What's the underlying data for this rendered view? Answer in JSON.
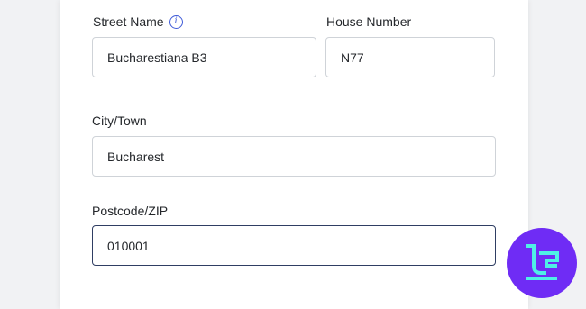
{
  "form": {
    "street": {
      "label": "Street Name",
      "value": "Bucharestiana B3",
      "info_icon": "info-icon"
    },
    "house": {
      "label": "House Number",
      "value": "N77"
    },
    "city": {
      "label": "City/Town",
      "value": "Bucharest"
    },
    "postcode": {
      "label": "Postcode/ZIP",
      "value": "010001",
      "focused": true
    }
  },
  "colors": {
    "accent": "#3f5bd8",
    "input_border": "#cfd3d8",
    "focused_border": "#2f3e63",
    "logo_bg": "#6f2cf5",
    "logo_fg": "#4ff0e6"
  },
  "logo": {
    "icon": "tradingfinder-logo"
  }
}
